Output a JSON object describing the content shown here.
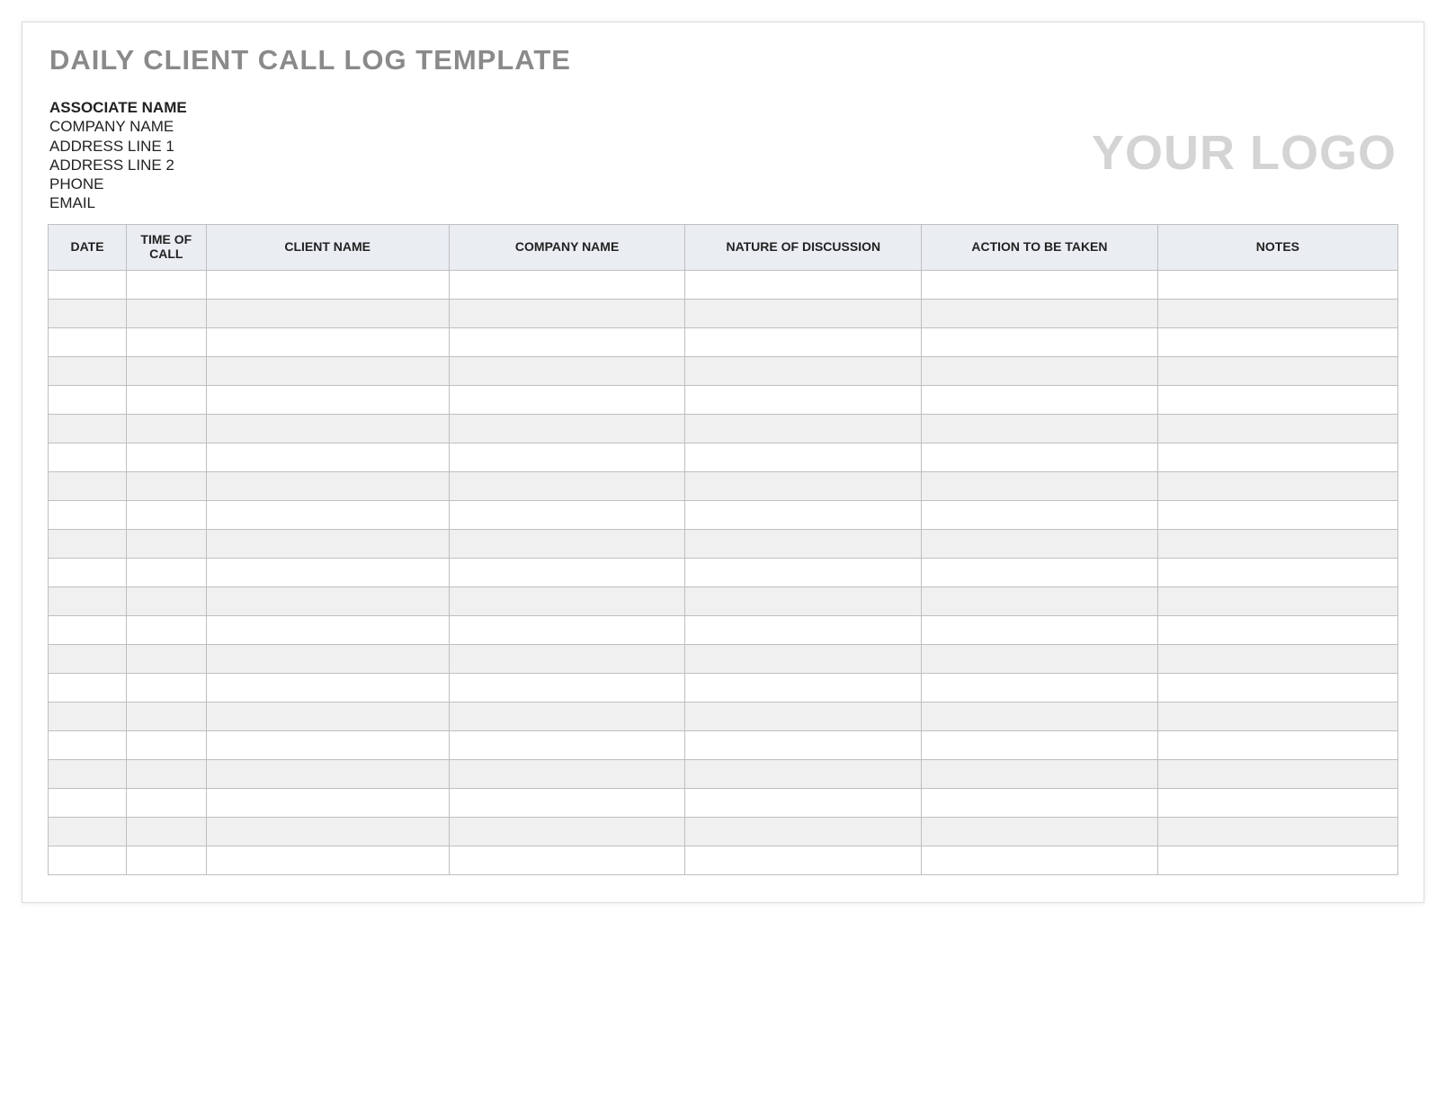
{
  "title": "DAILY CLIENT CALL LOG TEMPLATE",
  "info": {
    "associate": "ASSOCIATE NAME",
    "company": "COMPANY NAME",
    "address1": "ADDRESS LINE 1",
    "address2": "ADDRESS LINE 2",
    "phone": "PHONE",
    "email": "EMAIL"
  },
  "logo_text": "YOUR LOGO",
  "columns": [
    "DATE",
    "TIME OF CALL",
    "CLIENT NAME",
    "COMPANY NAME",
    "NATURE OF DISCUSSION",
    "ACTION TO BE TAKEN",
    "NOTES"
  ],
  "row_count": 21
}
